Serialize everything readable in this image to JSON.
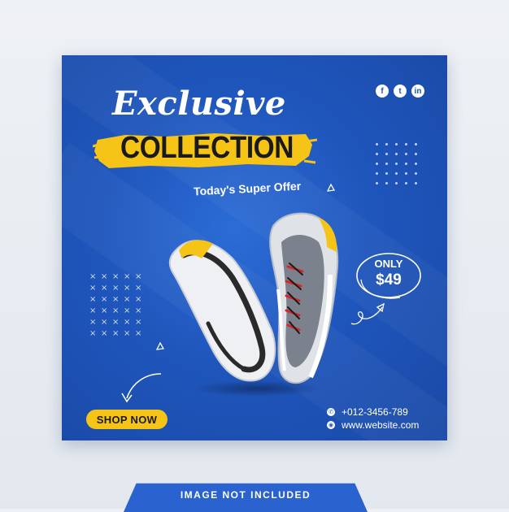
{
  "headline": {
    "script": "Exclusive",
    "main": "COLLECTION",
    "tagline": "Today's  Super Offer"
  },
  "price": {
    "label": "ONLY",
    "amount": "$49"
  },
  "cta": {
    "label": "SHOP NOW"
  },
  "contact": {
    "phone": "+012-3456-789",
    "website": "www.website.com"
  },
  "socials": [
    {
      "icon": "facebook-icon",
      "glyph": "f"
    },
    {
      "icon": "twitter-icon",
      "glyph": "t"
    },
    {
      "icon": "linkedin-icon",
      "glyph": "in"
    }
  ],
  "footer": {
    "note": "IMAGE NOT INCLUDED"
  },
  "colors": {
    "background": "#1f56bc",
    "accent": "#f6c317",
    "text": "#ffffff"
  }
}
